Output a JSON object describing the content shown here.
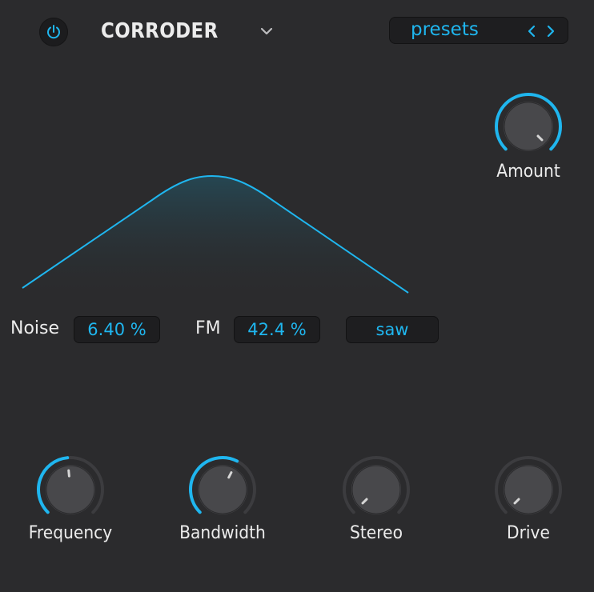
{
  "header": {
    "title": "CORRODER",
    "presets_label": "presets"
  },
  "controls": {
    "noise": {
      "label": "Noise",
      "value": "6.40 %"
    },
    "fm": {
      "label": "FM",
      "value": "42.4 %"
    },
    "waveform": {
      "value": "saw"
    }
  },
  "knobs": {
    "amount": {
      "label": "Amount",
      "level": 1.0
    },
    "frequency": {
      "label": "Frequency",
      "level": 0.48
    },
    "bandwidth": {
      "label": "Bandwidth",
      "level": 0.6
    },
    "stereo": {
      "label": "Stereo",
      "level": 0.0
    },
    "drive": {
      "label": "Drive",
      "level": 0.0
    }
  },
  "colors": {
    "accent": "#1fb6ef",
    "background": "#2b2b2d",
    "panel": "#1e1e20"
  },
  "icons": {
    "power": "power-icon",
    "dropdown": "chevron-down-icon",
    "prev": "chevron-left-icon",
    "next": "chevron-right-icon"
  }
}
